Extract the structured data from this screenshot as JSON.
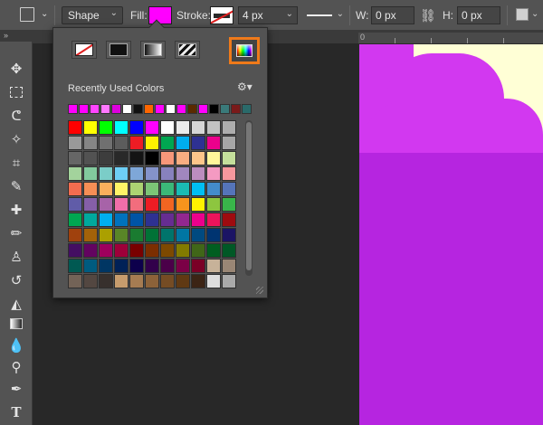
{
  "options_bar": {
    "tool_mode": "Shape",
    "fill_label": "Fill:",
    "fill_color": "#ff00ff",
    "stroke_label": "Stroke:",
    "stroke_width": "4 px",
    "width_label": "W:",
    "width_value": "0 px",
    "height_label": "H:",
    "height_value": "0 px"
  },
  "ruler": {
    "origin_label": "0"
  },
  "swatch_popup": {
    "modes": [
      "no-color",
      "solid-color",
      "gradient",
      "pattern"
    ],
    "color_picker_highlight": "#ef7a1a",
    "recent_title": "Recently Used Colors",
    "recent_colors": [
      "#ff00ff",
      "#ff00ff",
      "#ff44ff",
      "#ff77ff",
      "#dd00dd",
      "#ffffff",
      "#111111",
      "#ff6600",
      "#ff00ff",
      "#ffffff",
      "#ff00ff",
      "#5a2a00",
      "#ff00ff",
      "#000000",
      "#3a7a7a",
      "#7a1a1a",
      "#2a6a6a"
    ],
    "swatches": [
      "#ff0000",
      "#ffff00",
      "#00ff00",
      "#00ffff",
      "#0000ff",
      "#ff00ff",
      "#ffffff",
      "#ebebeb",
      "#d6d6d6",
      "#c2c2c2",
      "#adadad",
      "#999999",
      "#858585",
      "#707070",
      "#5c5c5c",
      "#ed1c24",
      "#fff200",
      "#00a651",
      "#00aeef",
      "#2e3192",
      "#ec008c",
      "#a6a6a6",
      "#666666",
      "#525252",
      "#3d3d3d",
      "#292929",
      "#141414",
      "#000000",
      "#f7977a",
      "#f9ad81",
      "#fdc68a",
      "#fff79a",
      "#c4df9b",
      "#a3d39c",
      "#82ca9d",
      "#7bcdc8",
      "#6ecff6",
      "#7ea7d8",
      "#8493ca",
      "#8882be",
      "#a187be",
      "#bc8dbf",
      "#f49ac2",
      "#f6989d",
      "#f26c4f",
      "#f68e55",
      "#fbaf5c",
      "#fff467",
      "#acd372",
      "#7cc576",
      "#3bb878",
      "#1abbb4",
      "#00bff3",
      "#438ccb",
      "#5574b9",
      "#605ca8",
      "#855fa8",
      "#a763a8",
      "#f06ea9",
      "#f26d7d",
      "#ed1c24",
      "#f26522",
      "#f7941d",
      "#fff200",
      "#8dc63f",
      "#39b54a",
      "#00a651",
      "#00a99d",
      "#00aeef",
      "#0072bc",
      "#0054a6",
      "#2e3192",
      "#662d91",
      "#92278f",
      "#ec008c",
      "#ed145b",
      "#9e0b0f",
      "#a0410d",
      "#a36209",
      "#aba000",
      "#598527",
      "#1a7b30",
      "#007236",
      "#00746b",
      "#0076a3",
      "#004a80",
      "#003471",
      "#1b1464",
      "#440e62",
      "#630460",
      "#9e005d",
      "#9e0039",
      "#790000",
      "#7b2e00",
      "#7d4900",
      "#827b00",
      "#406618",
      "#005e20",
      "#005826",
      "#005952",
      "#005b7f",
      "#003663",
      "#002157",
      "#0d004c",
      "#32004b",
      "#4b0049",
      "#7b0046",
      "#7a0026",
      "#c7b299",
      "#998675",
      "#736357",
      "#534741",
      "#37302d",
      "#c69c6d",
      "#a67c52",
      "#8c6239",
      "#754c24",
      "#603913",
      "#3c2415",
      "#dddddd",
      "#aaaaaa"
    ]
  }
}
